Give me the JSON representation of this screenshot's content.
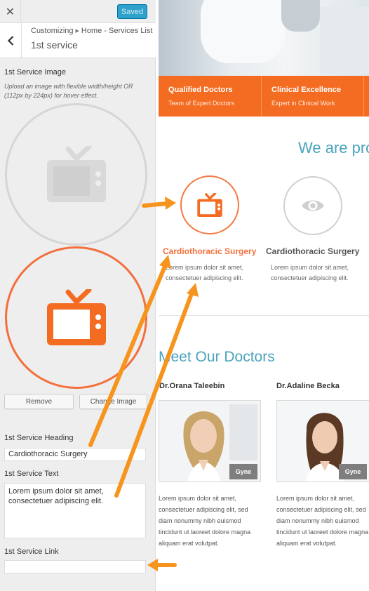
{
  "topbar": {
    "close_icon": "close-icon",
    "saved_label": "Saved"
  },
  "section": {
    "back_icon": "chevron-left-icon",
    "breadcrumb_prefix": "Customizing",
    "breadcrumb_path": "Home - Services List",
    "title": "1st service"
  },
  "image_control": {
    "label": "1st Service Image",
    "description": "Upload an image with flexible width/height OR (112px by 224px) for hover effect.",
    "remove_label": "Remove",
    "change_label": "Change Image",
    "icon": "tv-icon"
  },
  "heading_control": {
    "label": "1st Service Heading",
    "value": "Cardiothoracic Surgery"
  },
  "text_control": {
    "label": "1st Service Text",
    "value": "Lorem ipsum dolor sit amet, consectetuer adipiscing elit."
  },
  "link_control": {
    "label": "1st Service Link",
    "value": ""
  },
  "preview": {
    "features": [
      {
        "title": "Qualified Doctors",
        "subtitle": "Team of Expert Doctors"
      },
      {
        "title": "Clinical Excellence",
        "subtitle": "Expert in Clinical Work"
      }
    ],
    "services_heading": "We are pro",
    "services": [
      {
        "title": "Cardiothoracic Surgery",
        "text": "Lorem ipsum dolor sit amet, consectetuer adipiscing elit.",
        "icon": "tv-icon"
      },
      {
        "title": "Cardiothoracic Surgery",
        "text": "Lorem ipsum dolor sit amet, consectetuer adipiscing elit.",
        "icon": "eye-icon"
      }
    ],
    "doctors_heading": "Meet Our Doctors",
    "doctors": [
      {
        "name": "Dr.Orana Taleebin",
        "tag": "Gyne",
        "text": "Lorem ipsum dolor sit amet, consectetuer adipiscing elit, sed diam nonummy nibh euismod tincidunt ut laoreet dolore magna aliquam erat volutpat."
      },
      {
        "name": "Dr.Adaline Becka",
        "tag": "Gyne",
        "text": "Lorem ipsum dolor sit amet, consectetuer adipiscing elit, sed diam nonummy nibh euismod tincidunt ut laoreet dolore magna aliquam erat volutpat."
      }
    ]
  },
  "colors": {
    "accent_orange": "#f36c21",
    "heading_teal": "#4aa3bd",
    "saved_blue": "#2ea2cc",
    "arrow_orange": "#f7941d"
  }
}
